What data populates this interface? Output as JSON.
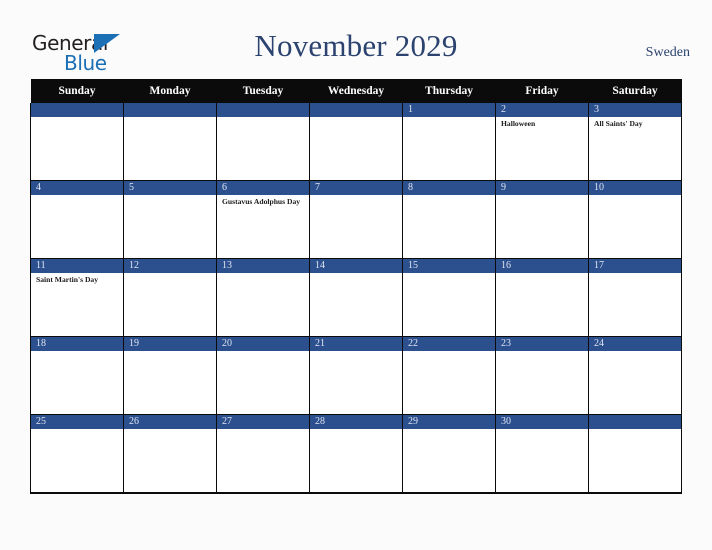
{
  "brand": {
    "name_part1": "General",
    "name_part2": "Blue",
    "triangle_color": "#1a6fb5"
  },
  "header": {
    "title": "November 2029",
    "country": "Sweden"
  },
  "colors": {
    "header_bar": "#0b0b0b",
    "day_banner": "#2c4f8e",
    "title_text": "#2b436e",
    "page_background": "#fbfbfc",
    "grid_line": "#0b0b0b"
  },
  "calendar": {
    "weekday_headers": [
      "Sunday",
      "Monday",
      "Tuesday",
      "Wednesday",
      "Thursday",
      "Friday",
      "Saturday"
    ],
    "weeks": [
      [
        {
          "day": "",
          "events": []
        },
        {
          "day": "",
          "events": []
        },
        {
          "day": "",
          "events": []
        },
        {
          "day": "",
          "events": []
        },
        {
          "day": "1",
          "events": []
        },
        {
          "day": "2",
          "events": [
            "Halloween"
          ]
        },
        {
          "day": "3",
          "events": [
            "All Saints' Day"
          ]
        }
      ],
      [
        {
          "day": "4",
          "events": []
        },
        {
          "day": "5",
          "events": []
        },
        {
          "day": "6",
          "events": [
            "Gustavus Adolphus Day"
          ]
        },
        {
          "day": "7",
          "events": []
        },
        {
          "day": "8",
          "events": []
        },
        {
          "day": "9",
          "events": []
        },
        {
          "day": "10",
          "events": []
        }
      ],
      [
        {
          "day": "11",
          "events": [
            "Saint Martin's Day"
          ]
        },
        {
          "day": "12",
          "events": []
        },
        {
          "day": "13",
          "events": []
        },
        {
          "day": "14",
          "events": []
        },
        {
          "day": "15",
          "events": []
        },
        {
          "day": "16",
          "events": []
        },
        {
          "day": "17",
          "events": []
        }
      ],
      [
        {
          "day": "18",
          "events": []
        },
        {
          "day": "19",
          "events": []
        },
        {
          "day": "20",
          "events": []
        },
        {
          "day": "21",
          "events": []
        },
        {
          "day": "22",
          "events": []
        },
        {
          "day": "23",
          "events": []
        },
        {
          "day": "24",
          "events": []
        }
      ],
      [
        {
          "day": "25",
          "events": []
        },
        {
          "day": "26",
          "events": []
        },
        {
          "day": "27",
          "events": []
        },
        {
          "day": "28",
          "events": []
        },
        {
          "day": "29",
          "events": []
        },
        {
          "day": "30",
          "events": []
        },
        {
          "day": "",
          "events": []
        }
      ]
    ]
  }
}
